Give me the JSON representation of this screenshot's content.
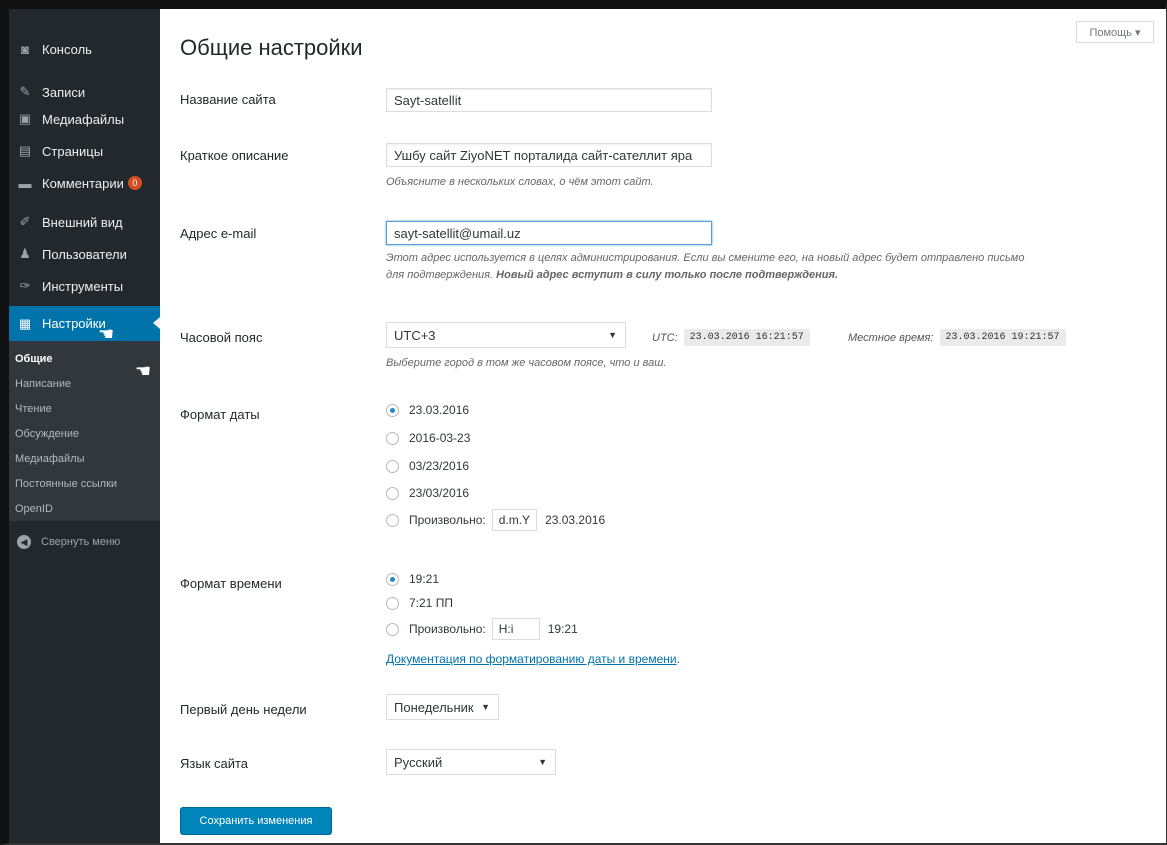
{
  "sidebar": {
    "items": [
      {
        "label": "Консоль",
        "icon": "dashboard-icon",
        "glyph": "◙"
      },
      {
        "label": "Записи",
        "icon": "pin-icon",
        "glyph": "✎"
      },
      {
        "label": "Медиафайлы",
        "icon": "media-icon",
        "glyph": "▣"
      },
      {
        "label": "Страницы",
        "icon": "pages-icon",
        "glyph": "▤"
      },
      {
        "label": "Комментарии",
        "icon": "comments-icon",
        "glyph": "▬",
        "badge": "0"
      },
      {
        "label": "Внешний вид",
        "icon": "appearance-icon",
        "glyph": "✐"
      },
      {
        "label": "Пользователи",
        "icon": "users-icon",
        "glyph": "♟"
      },
      {
        "label": "Инструменты",
        "icon": "tools-icon",
        "glyph": "✑"
      },
      {
        "label": "Настройки",
        "icon": "settings-icon",
        "glyph": "▦",
        "active": true
      }
    ],
    "submenu": [
      "Общие",
      "Написание",
      "Чтение",
      "Обсуждение",
      "Медиафайлы",
      "Постоянные ссылки",
      "OpenID"
    ],
    "collapse_label": "Свернуть меню"
  },
  "help_label": "Помощь ▾",
  "page_title": "Общие настройки",
  "fields": {
    "site_title": {
      "label": "Название сайта",
      "value": "Sayt-satellit"
    },
    "tagline": {
      "label": "Краткое описание",
      "value": "Ушбу сайт ZiyoNET порталида сайт-сателлит яра",
      "description": "Объясните в нескольких словах, о чём этот сайт."
    },
    "email": {
      "label": "Адрес e-mail",
      "value": "sayt-satellit@umail.uz",
      "description_1": "Этот адрес используется в целях администрирования. Если вы смените его, на новый адрес будет отправлено письмо",
      "description_2": "для подтверждения. ",
      "description_bold": "Новый адрес вступит в силу только после подтверждения."
    },
    "timezone": {
      "label": "Часовой пояс",
      "value": "UTC+3",
      "utc_label": "UTC:",
      "utc_time": "23.03.2016 16:21:57",
      "local_label": "Местное время:",
      "local_time": "23.03.2016 19:21:57",
      "description": "Выберите город в том же часовом поясе, что и ваш."
    },
    "date_format": {
      "label": "Формат даты",
      "options": [
        "23.03.2016",
        "2016-03-23",
        "03/23/2016",
        "23/03/2016"
      ],
      "custom_label": "Произвольно:",
      "custom_value": "d.m.Y",
      "custom_preview": "23.03.2016",
      "selected": 0
    },
    "time_format": {
      "label": "Формат времени",
      "options": [
        "19:21",
        "7:21 ПП"
      ],
      "custom_label": "Произвольно:",
      "custom_value": "H:i",
      "custom_preview": "19:21",
      "selected": 0,
      "doc_link": "Документация по форматированию даты и времени",
      "doc_link_suffix": "."
    },
    "week_start": {
      "label": "Первый день недели",
      "value": "Понедельник"
    },
    "language": {
      "label": "Язык сайта",
      "value": "Русский"
    }
  },
  "save_button": "Сохранить изменения",
  "colors": {
    "sidebar_bg": "#23282d",
    "active": "#0073aa",
    "button": "#0085ba",
    "link": "#0073aa"
  }
}
